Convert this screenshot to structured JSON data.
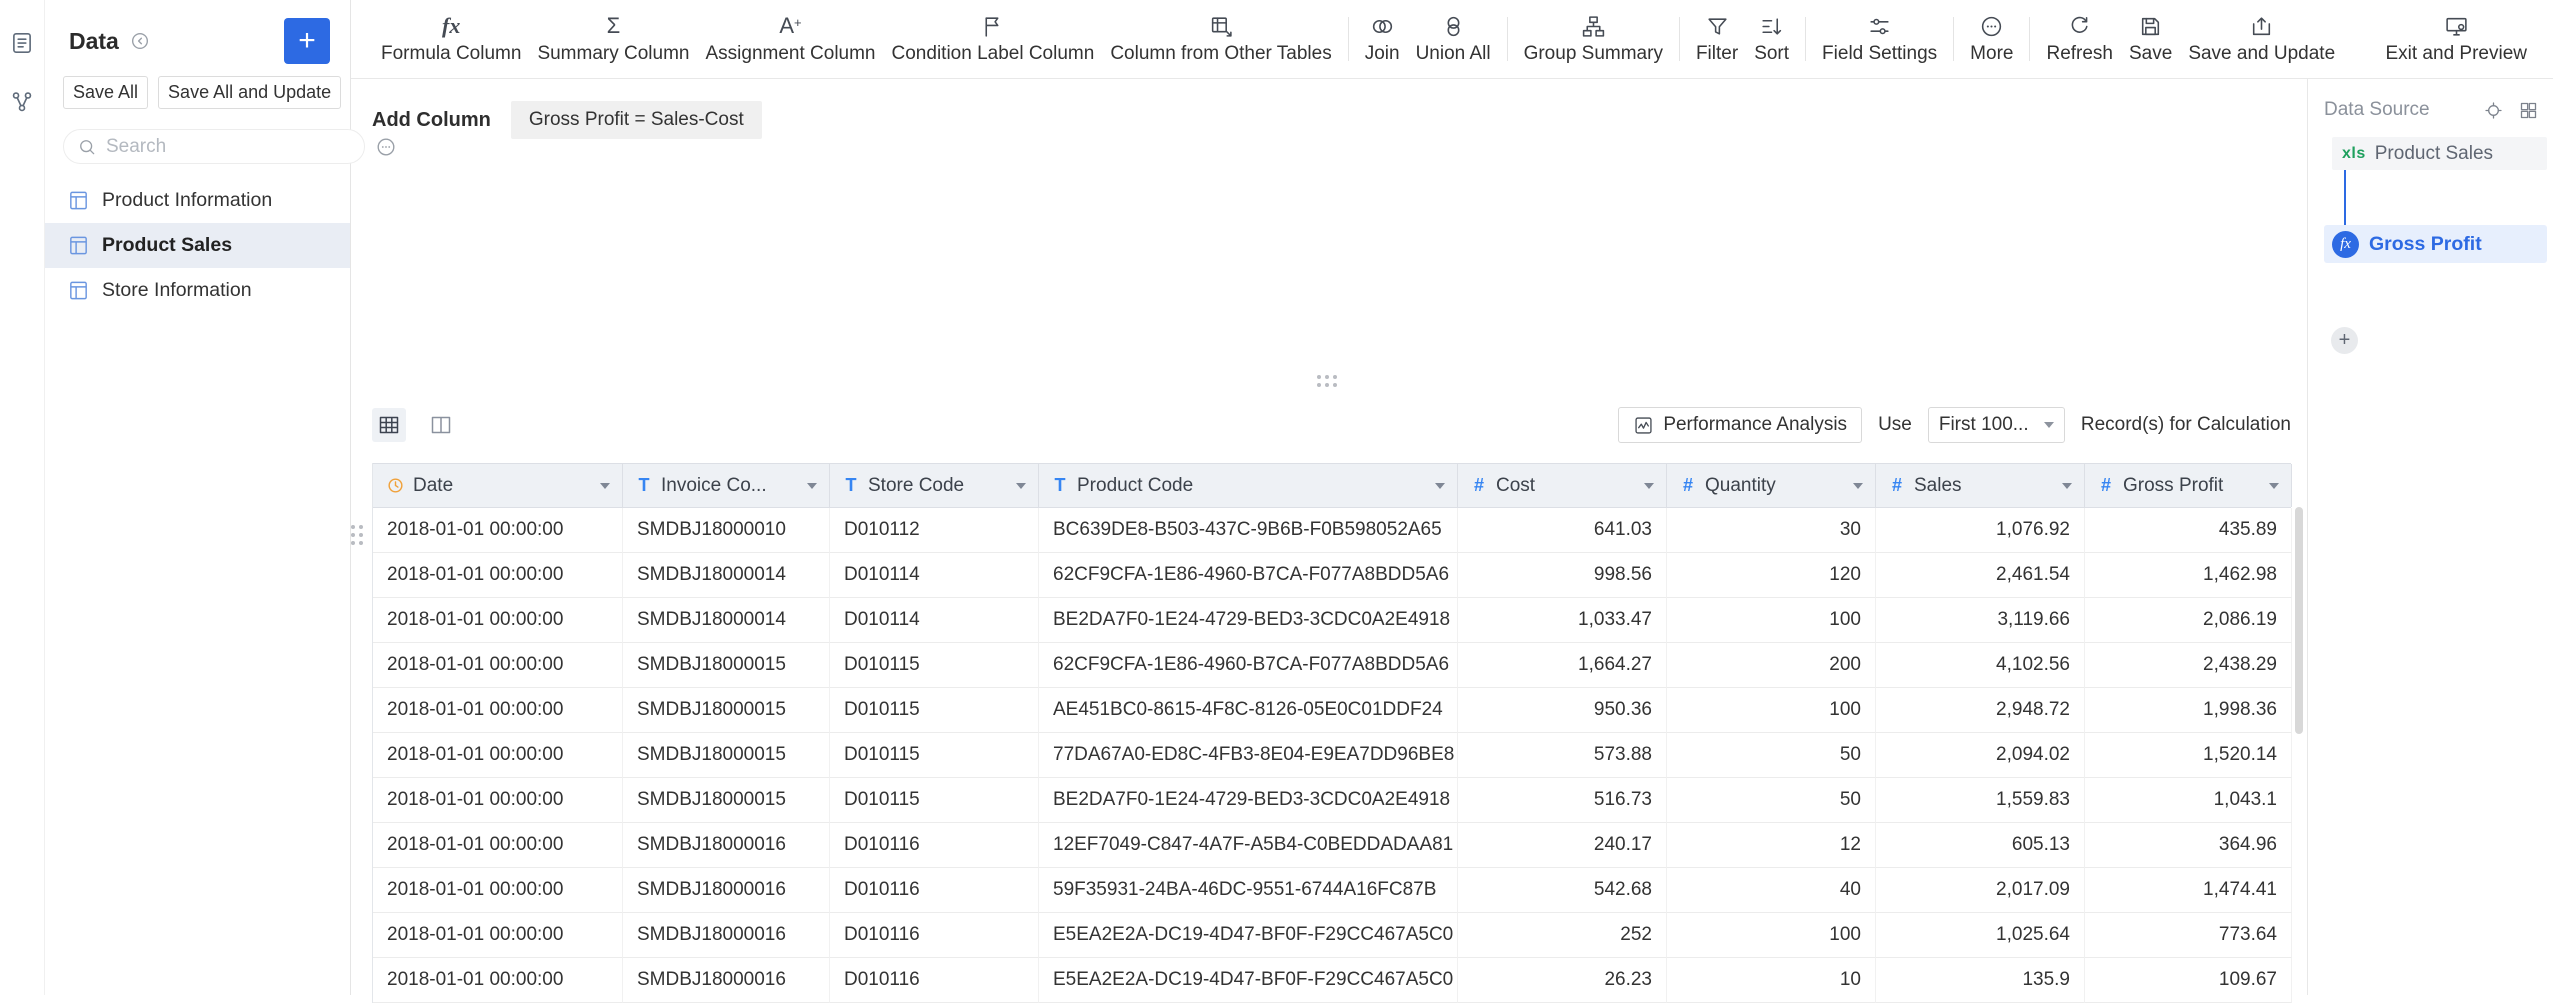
{
  "colors": {
    "accent": "#2d6ae3",
    "date_icon": "#f0a13a",
    "field_icon": "#3685f2",
    "header_bg": "#eef1f5"
  },
  "icons": {
    "date_field": "clock",
    "text_field": "T",
    "number_field": "#",
    "search": "magnifier",
    "add": "plus"
  },
  "sidebar": {
    "title": "Data",
    "save_all": "Save All",
    "save_all_and_update": "Save All and Update",
    "search_placeholder": "Search",
    "items": [
      {
        "label": "Product Information",
        "selected": false
      },
      {
        "label": "Product Sales",
        "selected": true
      },
      {
        "label": "Store Information",
        "selected": false
      }
    ]
  },
  "toolbar": {
    "items": [
      {
        "label": "Formula Column"
      },
      {
        "label": "Summary Column"
      },
      {
        "label": "Assignment Column"
      },
      {
        "label": "Condition Label Column"
      },
      {
        "label": "Column from Other Tables"
      },
      {
        "label": "Join"
      },
      {
        "label": "Union All"
      },
      {
        "label": "Group Summary"
      },
      {
        "label": "Filter"
      },
      {
        "label": "Sort"
      },
      {
        "label": "Field Settings"
      },
      {
        "label": "More"
      },
      {
        "label": "Refresh"
      },
      {
        "label": "Save"
      },
      {
        "label": "Save and Update"
      },
      {
        "label": "Exit and Preview"
      }
    ]
  },
  "canvas": {
    "add_column_label": "Add Column",
    "formula_chip": "Gross Profit = Sales-Cost"
  },
  "table_toolbar": {
    "performance_analysis": "Performance Analysis",
    "use_label": "Use",
    "record_count": "First 100...",
    "records_suffix": "Record(s) for Calculation"
  },
  "table": {
    "columns": [
      {
        "label": "Date",
        "type": "date"
      },
      {
        "label": "Invoice Co...",
        "type": "text"
      },
      {
        "label": "Store Code",
        "type": "text"
      },
      {
        "label": "Product Code",
        "type": "text"
      },
      {
        "label": "Cost",
        "type": "number"
      },
      {
        "label": "Quantity",
        "type": "number"
      },
      {
        "label": "Sales",
        "type": "number"
      },
      {
        "label": "Gross Profit",
        "type": "number"
      }
    ],
    "rows": [
      {
        "date": "2018-01-01 00:00:00",
        "invoice": "SMDBJ18000010",
        "store": "D010112",
        "product": "BC639DE8-B503-437C-9B6B-F0B598052A65",
        "cost": "641.03",
        "quantity": "30",
        "sales": "1,076.92",
        "gross_profit": "435.89"
      },
      {
        "date": "2018-01-01 00:00:00",
        "invoice": "SMDBJ18000014",
        "store": "D010114",
        "product": "62CF9CFA-1E86-4960-B7CA-F077A8BDD5A6",
        "cost": "998.56",
        "quantity": "120",
        "sales": "2,461.54",
        "gross_profit": "1,462.98"
      },
      {
        "date": "2018-01-01 00:00:00",
        "invoice": "SMDBJ18000014",
        "store": "D010114",
        "product": "BE2DA7F0-1E24-4729-BED3-3CDC0A2E4918",
        "cost": "1,033.47",
        "quantity": "100",
        "sales": "3,119.66",
        "gross_profit": "2,086.19"
      },
      {
        "date": "2018-01-01 00:00:00",
        "invoice": "SMDBJ18000015",
        "store": "D010115",
        "product": "62CF9CFA-1E86-4960-B7CA-F077A8BDD5A6",
        "cost": "1,664.27",
        "quantity": "200",
        "sales": "4,102.56",
        "gross_profit": "2,438.29"
      },
      {
        "date": "2018-01-01 00:00:00",
        "invoice": "SMDBJ18000015",
        "store": "D010115",
        "product": "AE451BC0-8615-4F8C-8126-05E0C01DDF24",
        "cost": "950.36",
        "quantity": "100",
        "sales": "2,948.72",
        "gross_profit": "1,998.36"
      },
      {
        "date": "2018-01-01 00:00:00",
        "invoice": "SMDBJ18000015",
        "store": "D010115",
        "product": "77DA67A0-ED8C-4FB3-8E04-E9EA7DD96BE8",
        "cost": "573.88",
        "quantity": "50",
        "sales": "2,094.02",
        "gross_profit": "1,520.14"
      },
      {
        "date": "2018-01-01 00:00:00",
        "invoice": "SMDBJ18000015",
        "store": "D010115",
        "product": "BE2DA7F0-1E24-4729-BED3-3CDC0A2E4918",
        "cost": "516.73",
        "quantity": "50",
        "sales": "1,559.83",
        "gross_profit": "1,043.1"
      },
      {
        "date": "2018-01-01 00:00:00",
        "invoice": "SMDBJ18000016",
        "store": "D010116",
        "product": "12EF7049-C847-4A7F-A5B4-C0BEDDADAA81",
        "cost": "240.17",
        "quantity": "12",
        "sales": "605.13",
        "gross_profit": "364.96"
      },
      {
        "date": "2018-01-01 00:00:00",
        "invoice": "SMDBJ18000016",
        "store": "D010116",
        "product": "59F35931-24BA-46DC-9551-6744A16FC87B",
        "cost": "542.68",
        "quantity": "40",
        "sales": "2,017.09",
        "gross_profit": "1,474.41"
      },
      {
        "date": "2018-01-01 00:00:00",
        "invoice": "SMDBJ18000016",
        "store": "D010116",
        "product": "E5EA2E2A-DC19-4D47-BF0F-F29CC467A5C0",
        "cost": "252",
        "quantity": "100",
        "sales": "1,025.64",
        "gross_profit": "773.64"
      },
      {
        "date": "2018-01-01 00:00:00",
        "invoice": "SMDBJ18000016",
        "store": "D010116",
        "product": "E5EA2E2A-DC19-4D47-BF0F-F29CC467A5C0",
        "cost": "26.23",
        "quantity": "10",
        "sales": "135.9",
        "gross_profit": "109.67"
      }
    ]
  },
  "data_source_panel": {
    "title": "Data Source",
    "source": {
      "badge": "xls",
      "label": "Product Sales"
    },
    "step": {
      "badge": "fx",
      "label": "Gross Profit"
    },
    "add_step_label": "+"
  }
}
